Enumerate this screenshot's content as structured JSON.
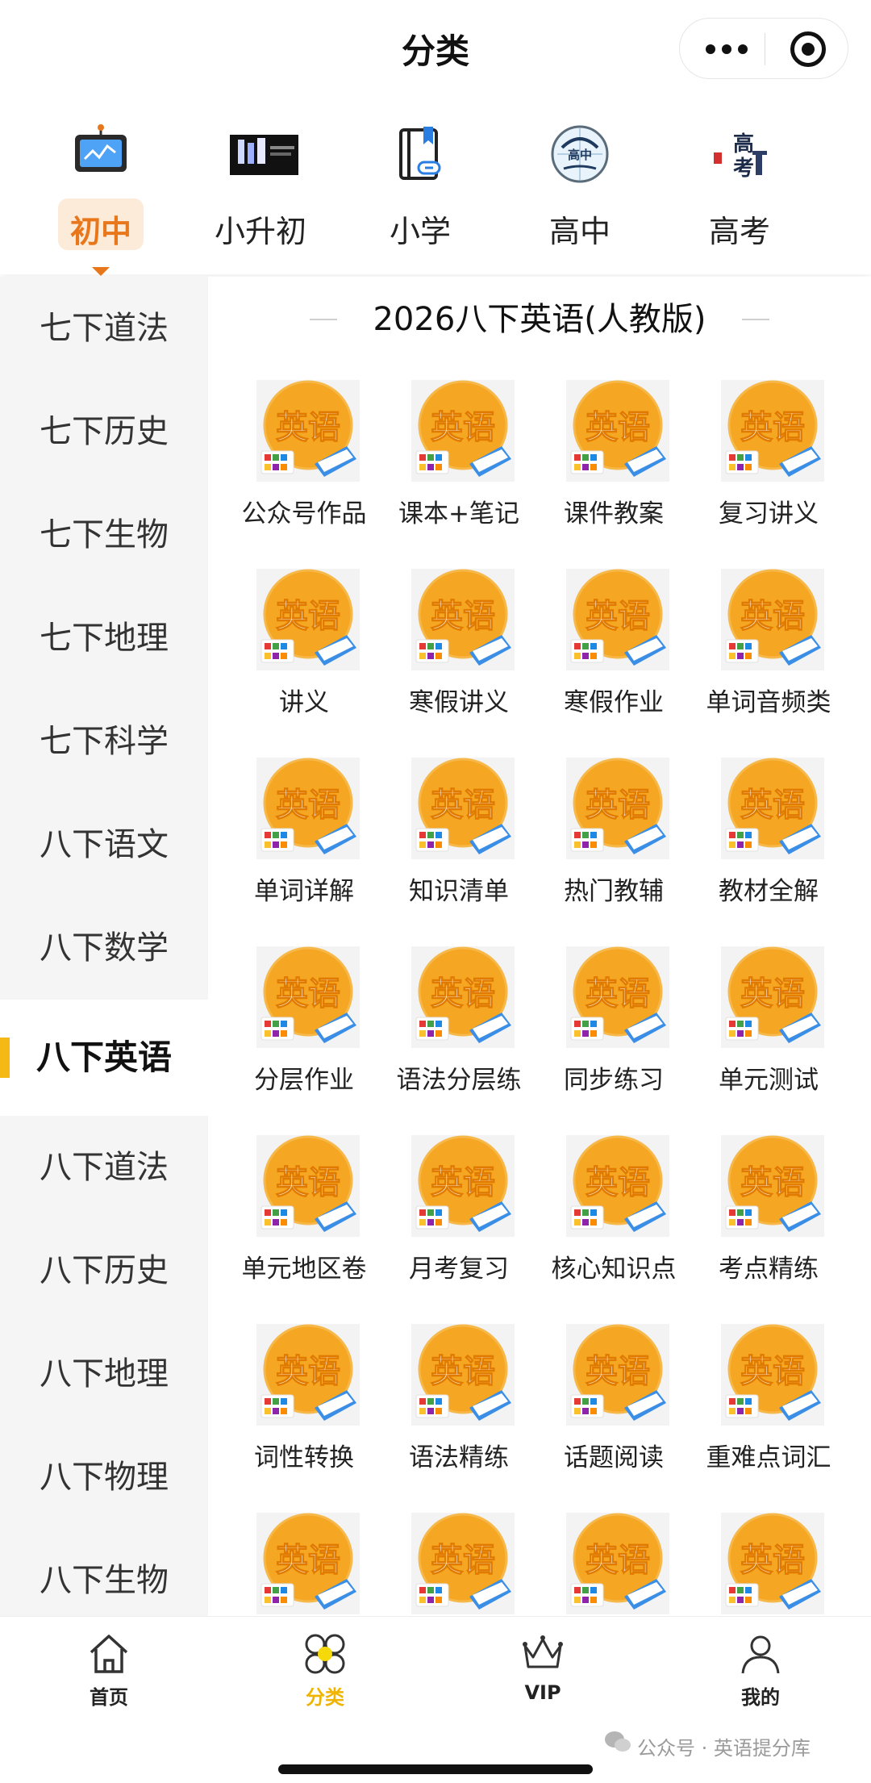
{
  "header": {
    "title": "分类"
  },
  "levels": [
    {
      "label": "初中",
      "icon": "whiteboard-icon",
      "active": true
    },
    {
      "label": "小升初",
      "icon": "banner-image-icon",
      "active": false
    },
    {
      "label": "小学",
      "icon": "book-link-icon",
      "active": false
    },
    {
      "label": "高中",
      "icon": "globe-book-icon",
      "active": false
    },
    {
      "label": "高考",
      "icon": "gaokao-gate-icon",
      "active": false
    }
  ],
  "sidebar": {
    "items": [
      {
        "label": "七下道法"
      },
      {
        "label": "七下历史"
      },
      {
        "label": "七下生物"
      },
      {
        "label": "七下地理"
      },
      {
        "label": "七下科学"
      },
      {
        "label": "八下语文"
      },
      {
        "label": "八下数学"
      },
      {
        "label": "八下英语",
        "active": true
      },
      {
        "label": "八下道法"
      },
      {
        "label": "八下历史"
      },
      {
        "label": "八下地理"
      },
      {
        "label": "八下物理"
      },
      {
        "label": "八下生物"
      }
    ]
  },
  "main": {
    "section_title": "2026八下英语(人教版)",
    "tile_icon_text": "英语",
    "tiles": [
      {
        "label": "公众号作品"
      },
      {
        "label": "课本+笔记"
      },
      {
        "label": "课件教案"
      },
      {
        "label": "复习讲义"
      },
      {
        "label": "讲义"
      },
      {
        "label": "寒假讲义"
      },
      {
        "label": "寒假作业"
      },
      {
        "label": "单词音频类"
      },
      {
        "label": "单词详解"
      },
      {
        "label": "知识清单"
      },
      {
        "label": "热门教辅"
      },
      {
        "label": "教材全解"
      },
      {
        "label": "分层作业"
      },
      {
        "label": "语法分层练"
      },
      {
        "label": "同步练习"
      },
      {
        "label": "单元测试"
      },
      {
        "label": "单元地区卷"
      },
      {
        "label": "月考复习"
      },
      {
        "label": "核心知识点"
      },
      {
        "label": "考点精练"
      },
      {
        "label": "词性转换"
      },
      {
        "label": "语法精练"
      },
      {
        "label": "话题阅读"
      },
      {
        "label": "重难点词汇"
      },
      {
        "label": ""
      },
      {
        "label": ""
      },
      {
        "label": ""
      },
      {
        "label": ""
      }
    ]
  },
  "tabbar": {
    "tabs": [
      {
        "label": "首页",
        "icon": "home-icon"
      },
      {
        "label": "分类",
        "icon": "category-icon",
        "active": true
      },
      {
        "label": "VIP",
        "icon": "crown-icon"
      },
      {
        "label": "我的",
        "icon": "profile-icon"
      }
    ],
    "watermark": "公众号 · 英语提分库"
  },
  "colors": {
    "accent_orange": "#e8761a",
    "accent_yellow": "#f5b916",
    "tile_orange": "#f5a623",
    "tab_active": "#f0b400"
  }
}
